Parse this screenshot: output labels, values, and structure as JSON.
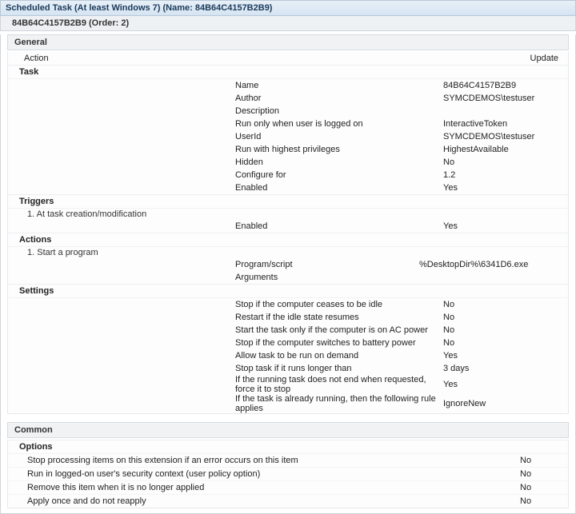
{
  "titlebar": "Scheduled Task (At least Windows 7) (Name: 84B64C4157B2B9)",
  "subbar": "84B64C4157B2B9 (Order: 2)",
  "sections": {
    "general": "General",
    "common": "Common"
  },
  "action_row": {
    "left": "Action",
    "right": "Update"
  },
  "task": {
    "header": "Task",
    "rows": [
      {
        "k": "Name",
        "v": "84B64C4157B2B9"
      },
      {
        "k": "Author",
        "v": "SYMCDEMOS\\testuser"
      },
      {
        "k": "Description",
        "v": ""
      },
      {
        "k": "Run only when user is logged on",
        "v": "InteractiveToken"
      },
      {
        "k": "UserId",
        "v": "SYMCDEMOS\\testuser"
      },
      {
        "k": "Run with highest privileges",
        "v": "HighestAvailable"
      },
      {
        "k": "Hidden",
        "v": "No"
      },
      {
        "k": "Configure for",
        "v": "1.2"
      },
      {
        "k": "Enabled",
        "v": "Yes"
      }
    ]
  },
  "triggers": {
    "header": "Triggers",
    "item": "1. At task creation/modification",
    "rows": [
      {
        "k": "Enabled",
        "v": "Yes"
      }
    ]
  },
  "actions": {
    "header": "Actions",
    "item": "1. Start a program",
    "rows": [
      {
        "k": "Program/script",
        "v": "%DesktopDir%\\6341D6.exe"
      },
      {
        "k": "Arguments",
        "v": ""
      }
    ]
  },
  "settings": {
    "header": "Settings",
    "rows": [
      {
        "k": "Stop if the computer ceases to be idle",
        "v": "No"
      },
      {
        "k": "Restart if the idle state resumes",
        "v": "No"
      },
      {
        "k": "Start the task only if the computer is on AC power",
        "v": "No"
      },
      {
        "k": "Stop if the computer switches to battery power",
        "v": "No"
      },
      {
        "k": "Allow task to be run on demand",
        "v": "Yes"
      },
      {
        "k": "Stop task if it runs longer than",
        "v": "3 days"
      },
      {
        "k": "If the running task does not end when requested, force it to stop",
        "v": "Yes"
      },
      {
        "k": "If the task is already running, then the following rule applies",
        "v": "IgnoreNew"
      }
    ]
  },
  "options": {
    "header": "Options",
    "rows": [
      {
        "k": "Stop processing items on this extension if an error occurs on this item",
        "v": "No"
      },
      {
        "k": "Run in logged-on user's security context (user policy option)",
        "v": "No"
      },
      {
        "k": "Remove this item when it is no longer applied",
        "v": "No"
      },
      {
        "k": "Apply once and do not reapply",
        "v": "No"
      }
    ]
  }
}
